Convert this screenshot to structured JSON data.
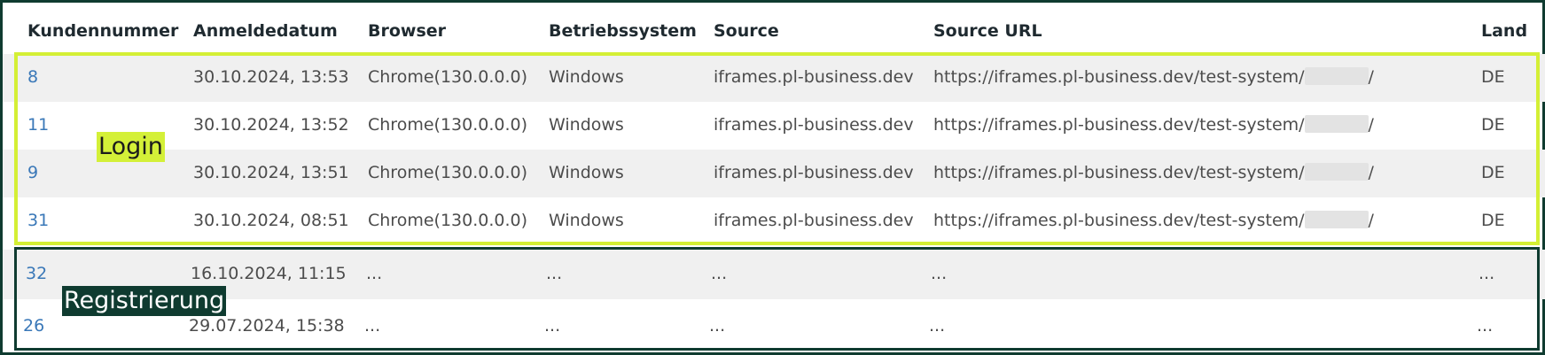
{
  "headers": {
    "kundennummer": "Kundennummer",
    "anmeldedatum": "Anmeldedatum",
    "browser": "Browser",
    "betriebssystem": "Betriebssystem",
    "source": "Source",
    "source_url": "Source URL",
    "land": "Land"
  },
  "labels": {
    "login": "Login",
    "registrierung": "Registrierung"
  },
  "colors": {
    "login_highlight": "#d4ef35",
    "registrierung_highlight": "#0f3b30",
    "link": "#3a78b8"
  },
  "login_rows": [
    {
      "kundennummer": "8",
      "anmeldedatum": "30.10.2024, 13:53",
      "browser": "Chrome(130.0.0.0)",
      "betriebssystem": "Windows",
      "source": "iframes.pl-business.dev",
      "source_url_prefix": "https://iframes.pl-business.dev/test-system/",
      "source_url_suffix": "/",
      "land": "DE"
    },
    {
      "kundennummer": "11",
      "anmeldedatum": "30.10.2024, 13:52",
      "browser": "Chrome(130.0.0.0)",
      "betriebssystem": "Windows",
      "source": "iframes.pl-business.dev",
      "source_url_prefix": "https://iframes.pl-business.dev/test-system/",
      "source_url_suffix": "/",
      "land": "DE"
    },
    {
      "kundennummer": "9",
      "anmeldedatum": "30.10.2024, 13:51",
      "browser": "Chrome(130.0.0.0)",
      "betriebssystem": "Windows",
      "source": "iframes.pl-business.dev",
      "source_url_prefix": "https://iframes.pl-business.dev/test-system/",
      "source_url_suffix": "/",
      "land": "DE"
    },
    {
      "kundennummer": "31",
      "anmeldedatum": "30.10.2024, 08:51",
      "browser": "Chrome(130.0.0.0)",
      "betriebssystem": "Windows",
      "source": "iframes.pl-business.dev",
      "source_url_prefix": "https://iframes.pl-business.dev/test-system/",
      "source_url_suffix": "/",
      "land": "DE"
    }
  ],
  "registrierung_rows": [
    {
      "kundennummer": "32",
      "anmeldedatum": "16.10.2024, 11:15",
      "browser": "...",
      "betriebssystem": "...",
      "source": "...",
      "source_url": "...",
      "land": "..."
    },
    {
      "kundennummer": "26",
      "anmeldedatum": "29.07.2024, 15:38",
      "browser": "...",
      "betriebssystem": "...",
      "source": "...",
      "source_url": "...",
      "land": "..."
    }
  ]
}
